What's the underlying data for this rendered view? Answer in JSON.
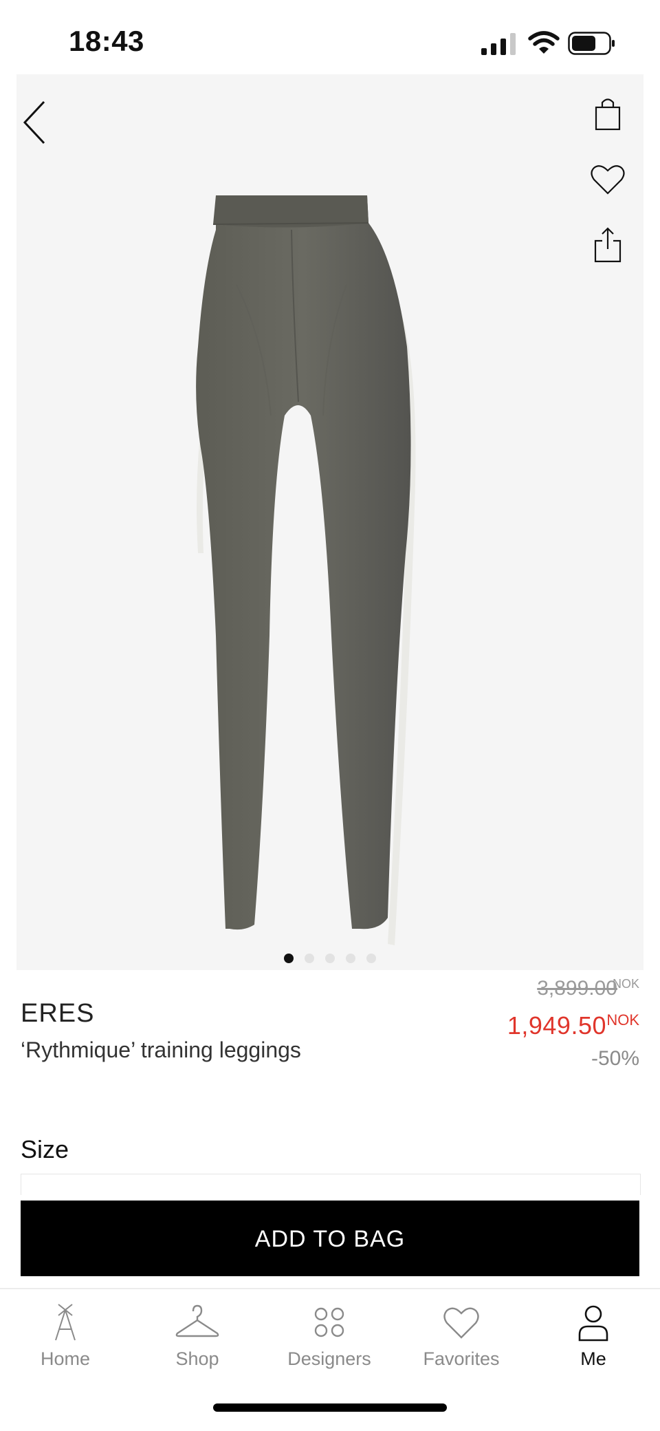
{
  "status_bar": {
    "time": "18:43",
    "icons": [
      "signal-icon",
      "wifi-icon",
      "battery-icon"
    ]
  },
  "product_image": {
    "actions": [
      "back-icon",
      "shopping-bag-icon",
      "heart-icon",
      "share-icon"
    ],
    "pager": {
      "total": 5,
      "active": 1
    }
  },
  "product": {
    "brand": "ERES",
    "name": "‘Rythmique’ training leggings",
    "original_price": "3,899.00",
    "original_currency": "NOK",
    "sale_price": "1,949.50",
    "sale_currency": "NOK",
    "discount": "-50%"
  },
  "size": {
    "label": "Size"
  },
  "actions": {
    "add_to_bag": "ADD TO BAG"
  },
  "tab_bar": {
    "tabs": [
      {
        "label": "Home",
        "icon": "home-logo-icon"
      },
      {
        "label": "Shop",
        "icon": "hanger-icon"
      },
      {
        "label": "Designers",
        "icon": "grid-circles-icon"
      },
      {
        "label": "Favorites",
        "icon": "heart-icon"
      },
      {
        "label": "Me",
        "icon": "person-icon"
      }
    ],
    "active": "Me"
  },
  "colors": {
    "sale": "#e0352b",
    "button": "#000000",
    "image_bg": "#f5f5f5"
  }
}
